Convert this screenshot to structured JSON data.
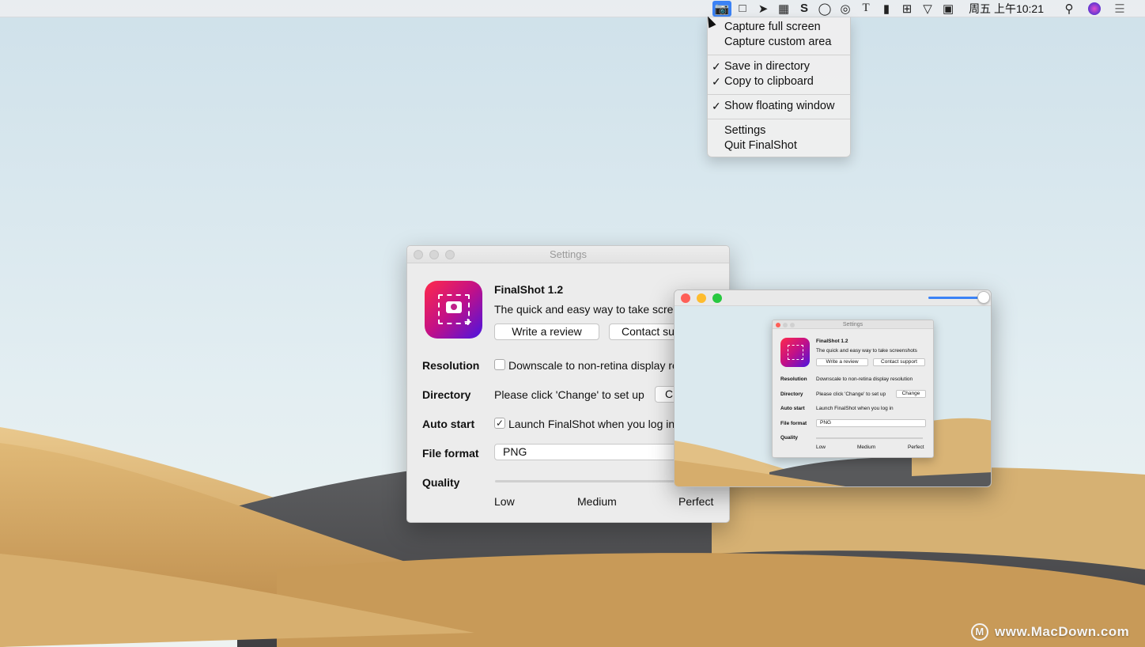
{
  "menubar": {
    "icons": [
      "finalshot-camera-icon",
      "video-camera-icon",
      "paper-plane-icon",
      "grid-bookmark-icon",
      "s-app-icon",
      "chat-bubble-icon",
      "overlap-circles-icon",
      "text-t-icon",
      "microphone-icon",
      "table-grid-icon",
      "wifi-icon",
      "sogou-input-icon"
    ],
    "clock": "周五 上午10:21"
  },
  "dropdown": {
    "items": [
      {
        "label": "Capture full screen",
        "checked": false
      },
      {
        "label": "Capture custom area",
        "checked": false
      },
      {
        "label": "Save in directory",
        "checked": true
      },
      {
        "label": "Copy to clipboard",
        "checked": true
      },
      {
        "label": "Show floating window",
        "checked": true
      },
      {
        "label": "Settings",
        "checked": false
      },
      {
        "label": "Quit FinalShot",
        "checked": false
      }
    ],
    "check_glyph": "✓"
  },
  "settings": {
    "title": "Settings",
    "app_name": "FinalShot 1.2",
    "tagline": "The quick and easy way to take scree",
    "review_button": "Write a review",
    "support_button": "Contact su",
    "resolution_label": "Resolution",
    "resolution_text": "Downscale to non-retina display re",
    "directory_label": "Directory",
    "directory_text": "Please click 'Change' to set up",
    "change_button": "C",
    "autostart_label": "Auto start",
    "autostart_text": "Launch FinalShot when you log in",
    "autostart_checked": "✓",
    "fileformat_label": "File format",
    "fileformat_value": "PNG",
    "quality_label": "Quality",
    "quality_low": "Low",
    "quality_medium": "Medium",
    "quality_perfect": "Perfect"
  },
  "preview": {
    "title": "Settings",
    "app_name": "FinalShot 1.2",
    "tagline": "The quick and easy way to take screenshots",
    "review_button": "Write a review",
    "support_button": "Contact support",
    "resolution_label": "Resolution",
    "resolution_text": "Downscale to non-retina display resolution",
    "directory_label": "Directory",
    "directory_text": "Please click 'Change' to set up",
    "change_button": "Change",
    "autostart_label": "Auto start",
    "autostart_text": "Launch FinalShot when you log in",
    "fileformat_label": "File format",
    "fileformat_value": "PNG",
    "quality_label": "Quality",
    "quality_low": "Low",
    "quality_medium": "Medium",
    "quality_perfect": "Perfect",
    "zoom_slider_fraction": 1.0
  },
  "watermark": {
    "logo": "M",
    "text": "www.MacDown.com"
  },
  "colors": {
    "accent": "#3b82f6",
    "close": "#fe5f57",
    "minimize": "#febc2e",
    "zoom": "#28c840"
  }
}
